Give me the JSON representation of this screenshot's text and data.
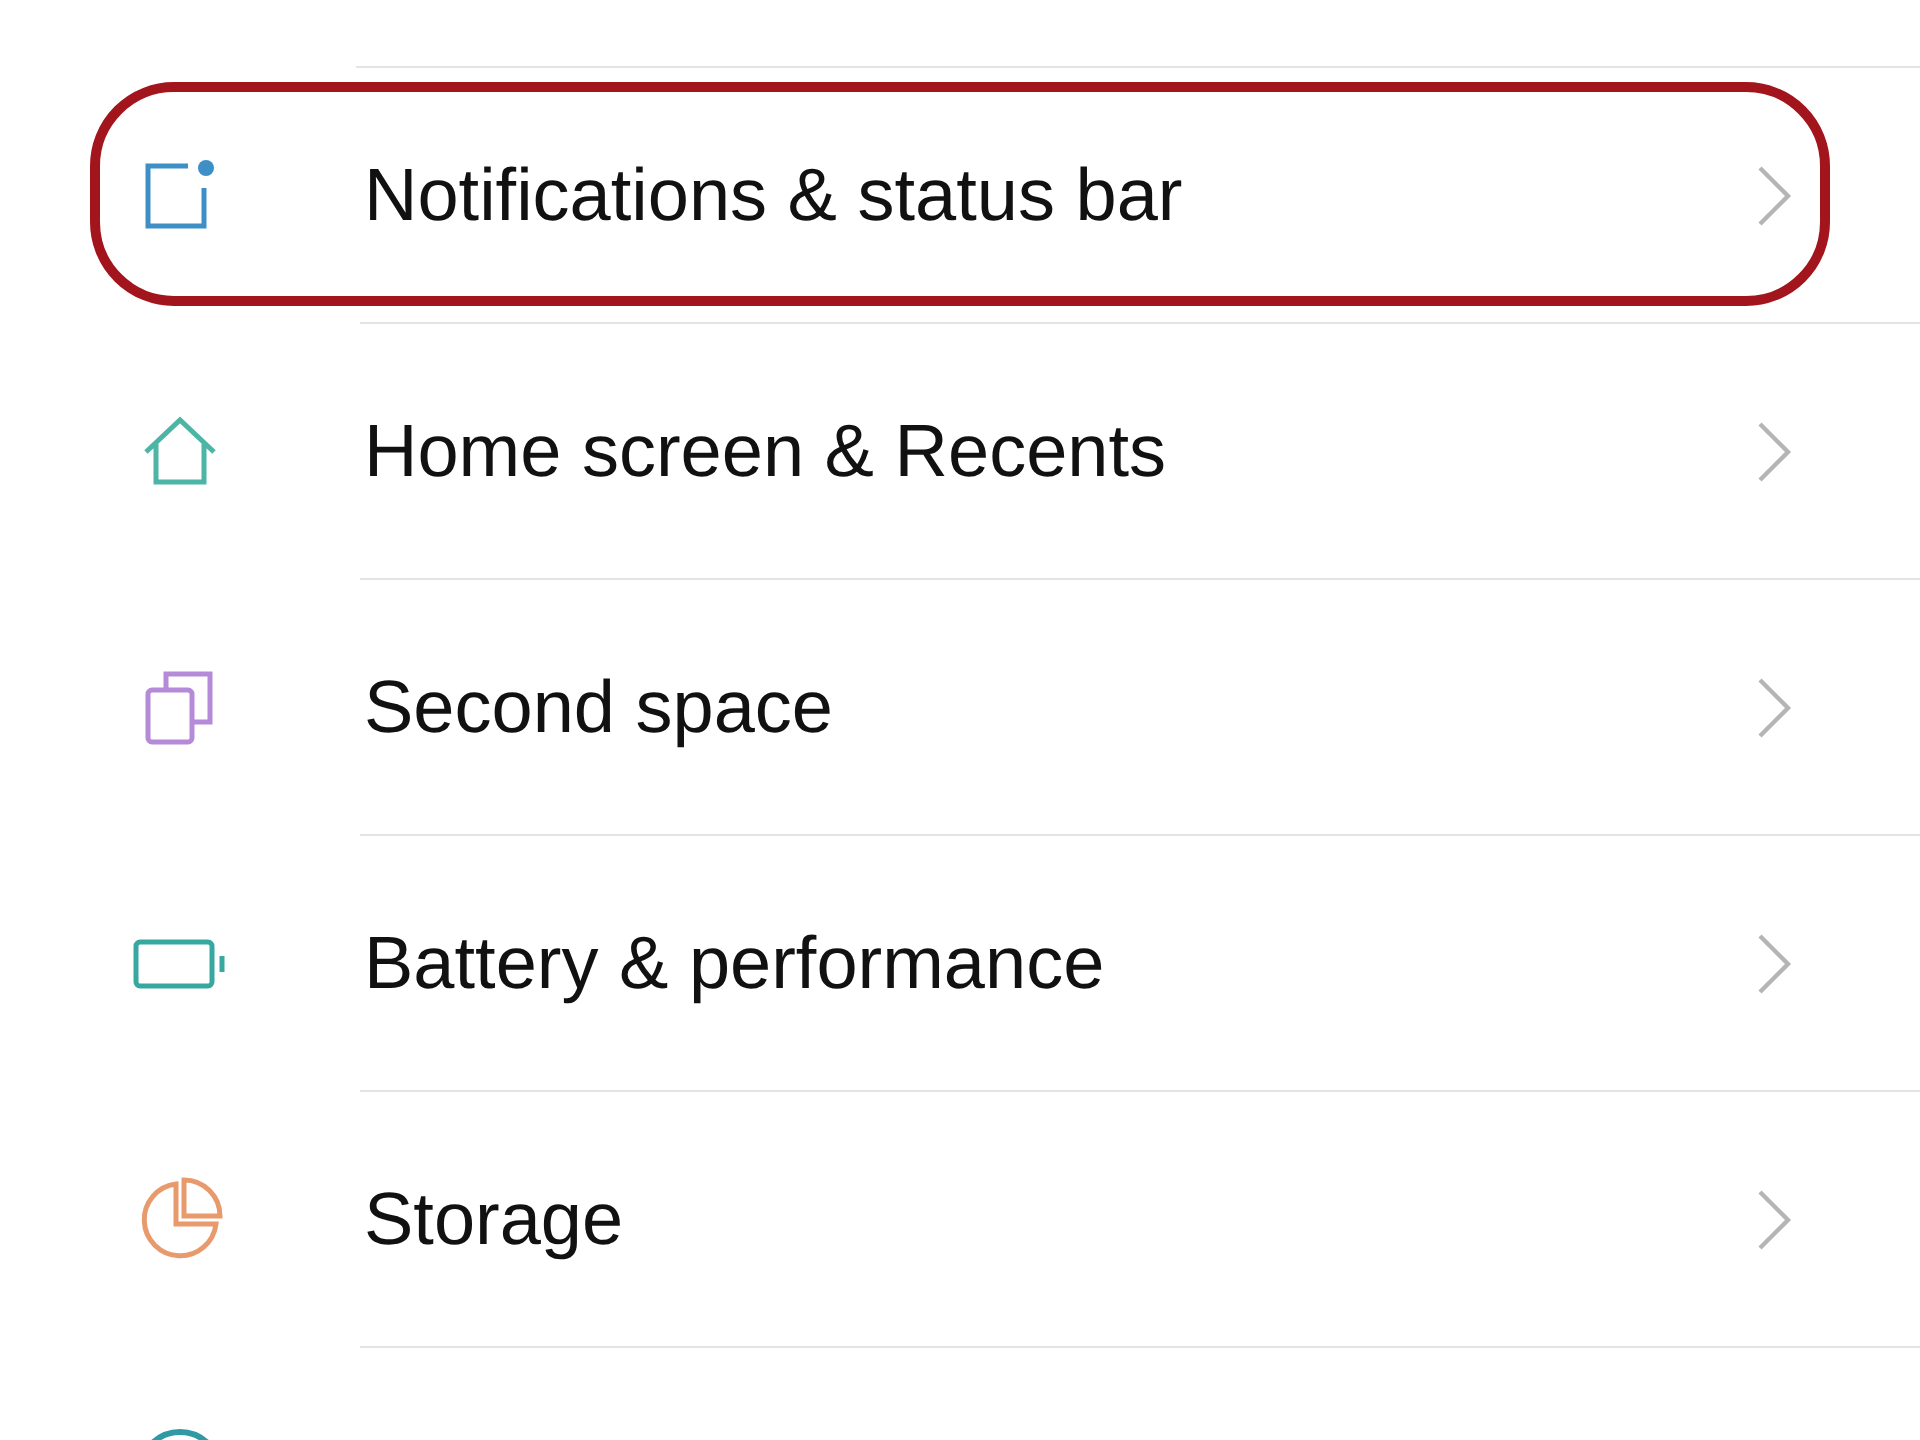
{
  "settings_items": [
    {
      "label": "Notifications & status bar",
      "kind": "notification",
      "color": "#3d8fc6",
      "highlighted": true
    },
    {
      "label": "Home screen & Recents",
      "kind": "home",
      "color": "#4cb5a5",
      "highlighted": false
    },
    {
      "label": "Second space",
      "kind": "copies",
      "color": "#b48ad9",
      "highlighted": false
    },
    {
      "label": "Battery & performance",
      "kind": "battery",
      "color": "#37a89f",
      "highlighted": false
    },
    {
      "label": "Storage",
      "kind": "pie",
      "color": "#e99a6c",
      "highlighted": false
    }
  ],
  "cut_off_item": {
    "kind": "circle",
    "color": "#2f9aa3"
  }
}
